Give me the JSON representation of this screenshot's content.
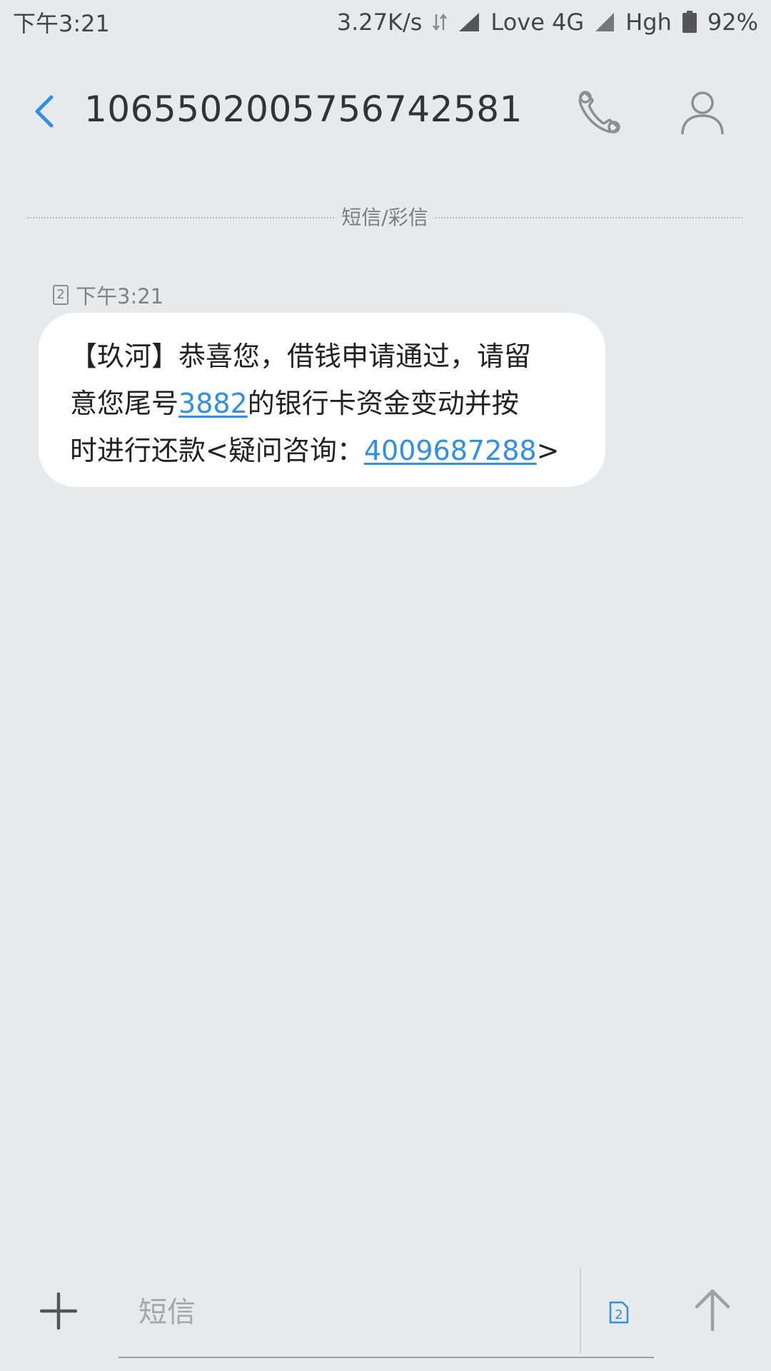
{
  "status_bar": {
    "time": "下午3:21",
    "net_speed": "3.27K/s",
    "carrier1": "Love 4G",
    "carrier2": "Hgh",
    "battery": "92%",
    "battery_level": 0.92
  },
  "header": {
    "contact_number": "1065502005756742581"
  },
  "divider": {
    "label": "短信/彩信"
  },
  "messages": [
    {
      "sim": "2",
      "time": "下午3:21",
      "parts": {
        "p1": "【玖河】恭喜您，借钱申请通过，请留",
        "p2": "意您尾号",
        "link1": "3882",
        "p3": "的银行卡资金变动并按",
        "p4": "时进行还款<疑问咨询：",
        "link2": "4009687288",
        "p5": ">"
      }
    }
  ],
  "composer": {
    "placeholder": "短信",
    "sim_label": "2"
  },
  "colors": {
    "accent": "#2f8fe6",
    "background": "#e7eaed",
    "bubble": "#ffffff"
  },
  "icons": {
    "back": "chevron-left-icon",
    "call": "phone-icon",
    "contact": "person-icon",
    "add": "plus-icon",
    "sim": "sim-card-icon",
    "send": "arrow-up-icon"
  }
}
